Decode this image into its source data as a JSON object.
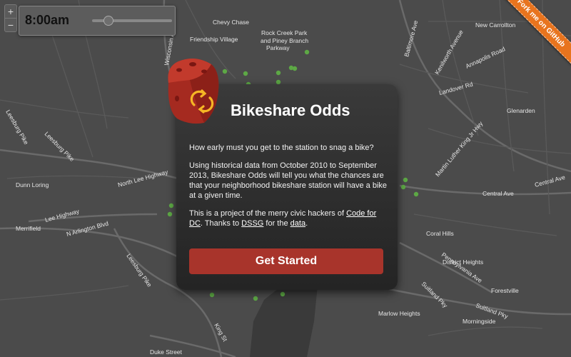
{
  "map": {
    "labels": [
      {
        "text": "Chevy Chase"
      },
      {
        "text": "Friendship Village"
      },
      {
        "text": "Rock Creek Park"
      },
      {
        "text": "and Piney Branch"
      },
      {
        "text": "Parkway"
      },
      {
        "text": "New Carrollton"
      },
      {
        "text": "Annapolis Road"
      },
      {
        "text": "Landover Rd"
      },
      {
        "text": "Glenarden"
      },
      {
        "text": "Leesburg Pike"
      },
      {
        "text": "North Lee Highway"
      },
      {
        "text": "Dunn Loring"
      },
      {
        "text": "Lee Highway"
      },
      {
        "text": "Merrifield"
      },
      {
        "text": "N Arlington Blvd"
      },
      {
        "text": "Central Ave"
      },
      {
        "text": "Central Ave"
      },
      {
        "text": "Coral Hills"
      },
      {
        "text": "District Heights"
      },
      {
        "text": "Forestville"
      },
      {
        "text": "Marlow Heights"
      },
      {
        "text": "Morningside"
      },
      {
        "text": "Suitland Pky"
      },
      {
        "text": "Suitland Pky"
      },
      {
        "text": "Pennsylvania Ave"
      },
      {
        "text": "Martin Luther King Jr Hwy"
      },
      {
        "text": "Kenilworth Avenue"
      },
      {
        "text": "Baltimore Ave"
      },
      {
        "text": "King St"
      },
      {
        "text": "Duke Street"
      },
      {
        "text": "Leesburg Pike"
      },
      {
        "text": "Leesburg Pike"
      },
      {
        "text": "Wisconsin Ave"
      }
    ],
    "zoom_in_label": "+",
    "zoom_out_label": "−"
  },
  "time_control": {
    "time": "8:00am",
    "slider_fraction": 0.2
  },
  "ribbon": {
    "label": "Fork me on GitHub"
  },
  "modal": {
    "title": "Bikeshare Odds",
    "p1": "How early must you get to the station to snag a bike?",
    "p2": "Using historical data from October 2010 to September 2013, Bikeshare Odds will tell you what the chances are that your neighborhood bikeshare station will have a bike at a given time.",
    "p3_prefix": "This is a project of the merry civic hackers of ",
    "p3_link": "Code for DC",
    "p3_mid": ". Thanks to ",
    "p3_link2": "DSSG",
    "p3_mid2": " for the ",
    "p3_link3": "data",
    "p3_end": ".",
    "button": "Get Started"
  },
  "colors": {
    "accent": "#a8342b",
    "ribbon": "#e8741e",
    "station": "#5da845"
  }
}
